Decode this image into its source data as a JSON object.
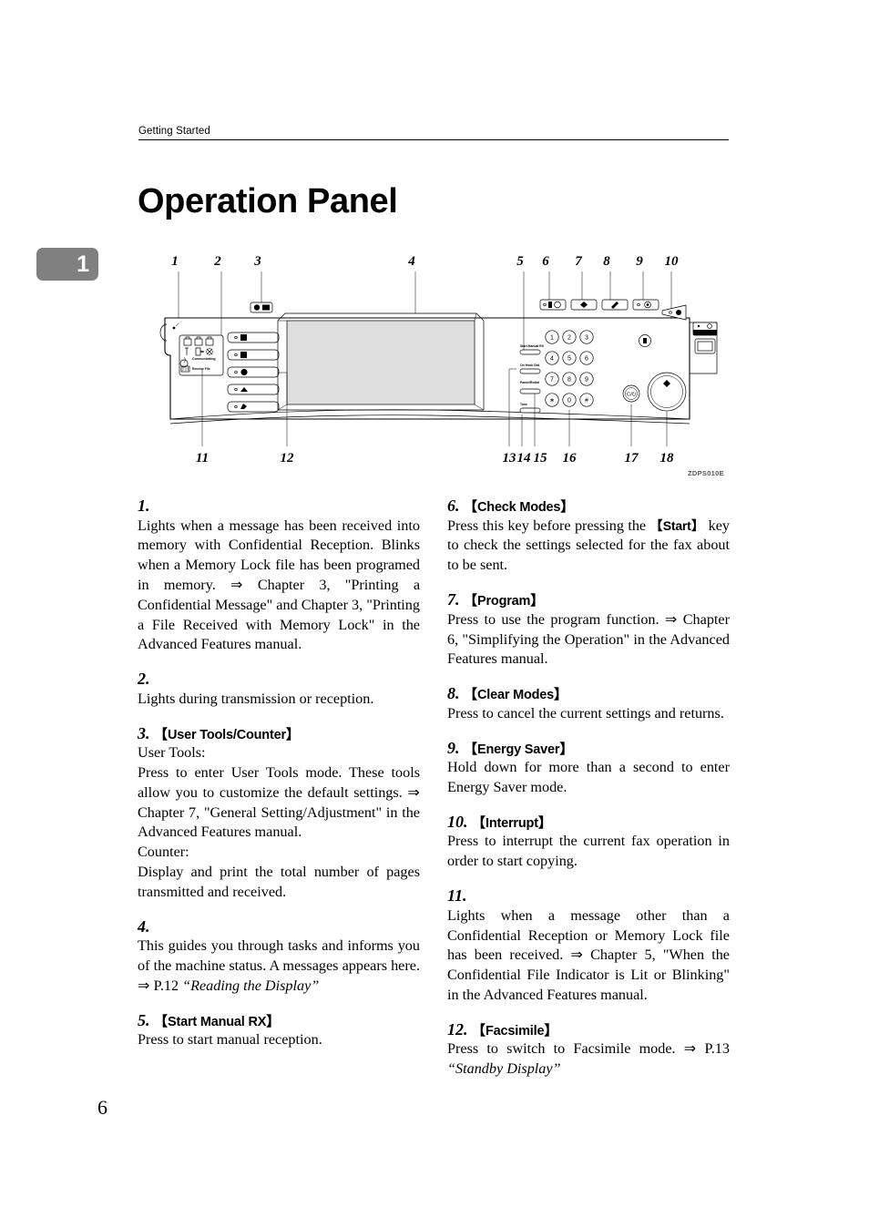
{
  "header": {
    "running_head": "Getting Started",
    "title": "Operation Panel"
  },
  "chapter_tab": "1",
  "page_number": "6",
  "figure": {
    "code": "ZDPS010E",
    "callouts_top": [
      "1",
      "2",
      "3",
      "4",
      "5",
      "6",
      "7",
      "8",
      "9",
      "10"
    ],
    "callouts_bottom": [
      "11",
      "12",
      "13",
      "14",
      "15",
      "16",
      "17",
      "18"
    ],
    "panel_labels": {
      "communicating": "Communicating",
      "receive_file": "Receive File",
      "start_manual_rx": "Start Manual RX",
      "on_hook_dial": "On Hook Dial",
      "pause_redial": "Pause/Redial",
      "tone": "Tone"
    },
    "keypad": [
      "1",
      "2",
      "3",
      "4",
      "5",
      "6",
      "7",
      "8",
      "9",
      "∗",
      "0",
      "#"
    ],
    "clear_stop_label": "C/⏻"
  },
  "items": {
    "left": [
      {
        "num": "1.",
        "key": "",
        "paras": [
          "Lights when a message has been received into memory with Confidential Reception. Blinks when a Memory Lock file has been programed in memory. ⇒ Chapter 3, \"Printing a Confidential Message\" and Chapter 3, \"Printing a File Received with Memory Lock\" in the Advanced Features manual."
        ]
      },
      {
        "num": "2.",
        "key": "",
        "paras": [
          "Lights during transmission or reception."
        ]
      },
      {
        "num": "3.",
        "key": "User Tools/Counter",
        "paras": [
          "User Tools:",
          "Press to enter User Tools mode. These tools allow you to customize the default settings. ⇒ Chapter 7, \"General Setting/Adjustment\" in the Advanced Features manual.",
          "Counter:",
          "Display and print the total number of pages transmitted and received."
        ]
      },
      {
        "num": "4.",
        "key": "",
        "paras": [
          "This guides you through tasks and informs you of the machine status. A messages appears here. ⇒ P.12 “Reading the Display”"
        ]
      },
      {
        "num": "5.",
        "key": "Start Manual RX",
        "paras": [
          "Press to start manual reception."
        ]
      }
    ],
    "right": [
      {
        "num": "6.",
        "key": "Check Modes",
        "paras": [
          "Press this key before pressing the 【Start】 key to check the settings selected for the fax about to be sent."
        ]
      },
      {
        "num": "7.",
        "key": "Program",
        "paras": [
          "Press to use the program function. ⇒ Chapter 6, \"Simplifying the Operation\" in the Advanced Features manual."
        ]
      },
      {
        "num": "8.",
        "key": "Clear Modes",
        "paras": [
          "Press to cancel the current settings and returns."
        ]
      },
      {
        "num": "9.",
        "key": "Energy Saver",
        "paras": [
          "Hold down for more than a second to enter Energy Saver mode."
        ]
      },
      {
        "num": "10.",
        "key": "Interrupt",
        "paras": [
          "Press to interrupt the current fax operation in order to start copying."
        ]
      },
      {
        "num": "11.",
        "key": "",
        "paras": [
          "Lights when a message other than a Confidential Reception or Memory Lock file has been received. ⇒ Chapter 5, \"When the Confidential File Indicator is Lit or Blinking\" in the Advanced Features manual."
        ]
      },
      {
        "num": "12.",
        "key": "Facsimile",
        "paras": [
          "Press to switch to Facsimile mode. ⇒ P.13 “Standby Display”"
        ]
      }
    ]
  },
  "inline_keys": {
    "start": "Start"
  }
}
